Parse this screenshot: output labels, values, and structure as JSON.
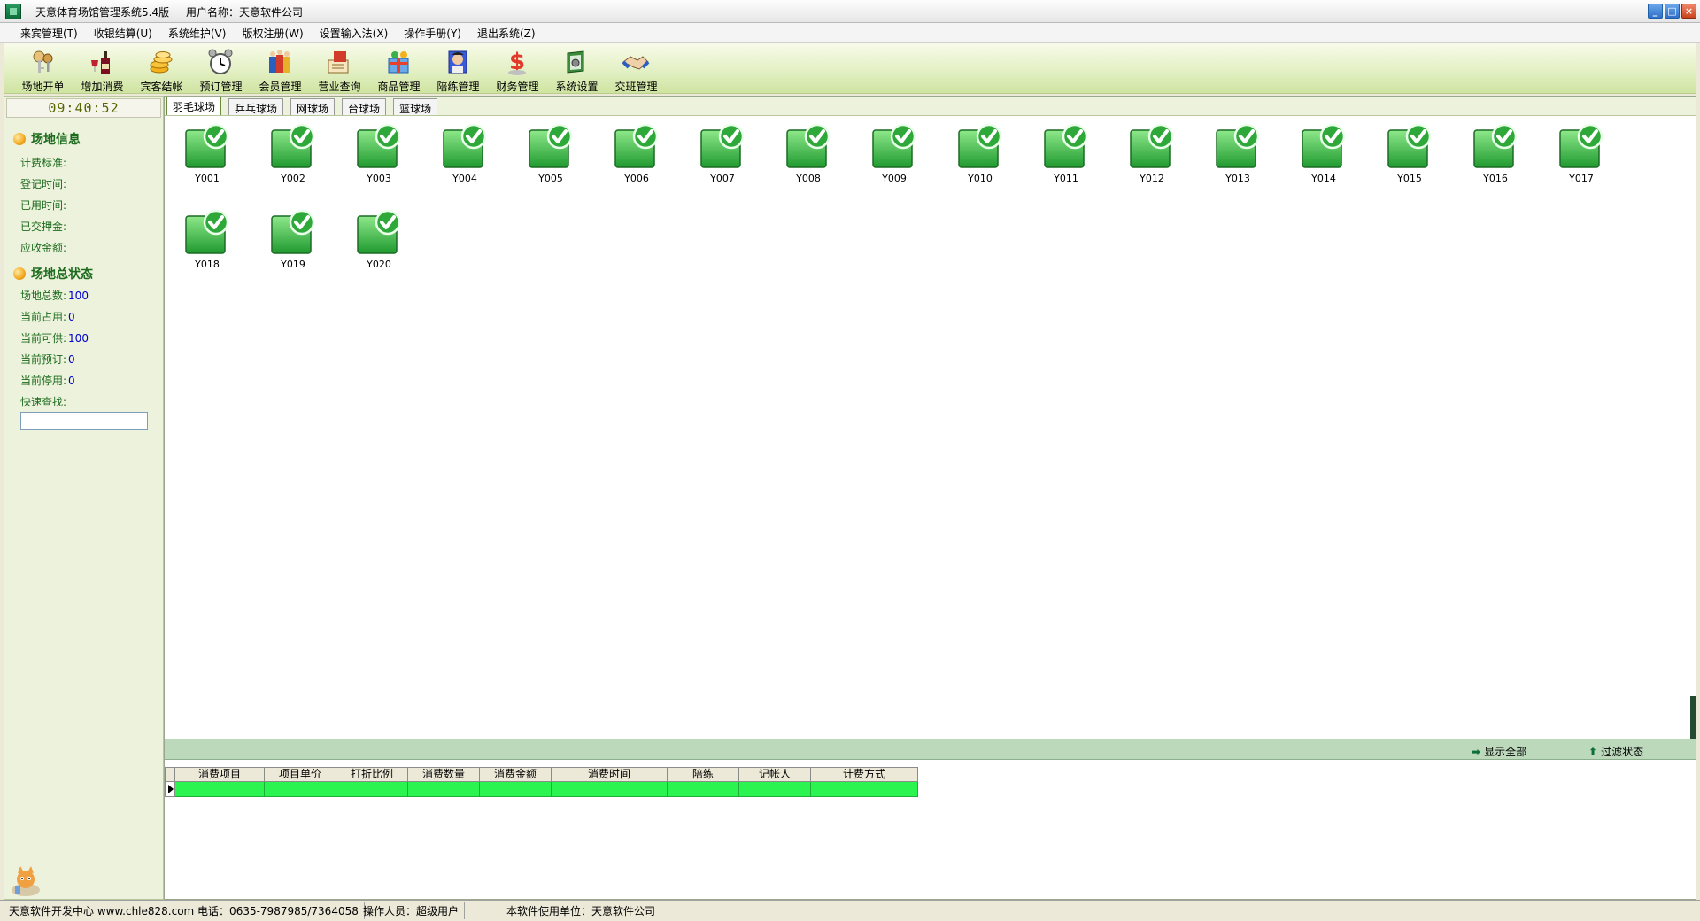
{
  "window": {
    "title": "天意体育场馆管理系统5.4版",
    "user": "用户名称：天意软件公司"
  },
  "menu": [
    "来宾管理(T)",
    "收银结算(U)",
    "系统维护(V)",
    "版权注册(W)",
    "设置输入法(X)",
    "操作手册(Y)",
    "退出系统(Z)"
  ],
  "toolbar": [
    {
      "label": "场地开单",
      "icon": "keys-icon"
    },
    {
      "label": "增加消费",
      "icon": "wine-bottle-icon"
    },
    {
      "label": "宾客结帐",
      "icon": "coins-icon"
    },
    {
      "label": "预订管理",
      "icon": "alarm-clock-icon"
    },
    {
      "label": "会员管理",
      "icon": "members-icon"
    },
    {
      "label": "营业查询",
      "icon": "ledger-icon"
    },
    {
      "label": "商品管理",
      "icon": "gift-box-icon"
    },
    {
      "label": "陪练管理",
      "icon": "trainer-icon"
    },
    {
      "label": "财务管理",
      "icon": "money-icon"
    },
    {
      "label": "系统设置",
      "icon": "settings-book-icon"
    },
    {
      "label": "交班管理",
      "icon": "handshake-icon"
    }
  ],
  "clock": "09:40:52",
  "venue_info": {
    "title": "场地信息",
    "fields": [
      "计费标准:",
      "登记时间:",
      "已用时间:",
      "已交押金:",
      "应收金额:"
    ]
  },
  "venue_status": {
    "title": "场地总状态",
    "fields": [
      {
        "label": "场地总数:",
        "value": "100"
      },
      {
        "label": "当前占用:",
        "value": "0"
      },
      {
        "label": "当前可供:",
        "value": "100"
      },
      {
        "label": "当前预订:",
        "value": "0"
      },
      {
        "label": "当前停用:",
        "value": "0"
      }
    ],
    "quick_search_label": "快速查找:",
    "quick_search_value": ""
  },
  "tabs": [
    {
      "label": "羽毛球场",
      "active": true
    },
    {
      "label": "乒乓球场",
      "active": false
    },
    {
      "label": "网球场",
      "active": false
    },
    {
      "label": "台球场",
      "active": false
    },
    {
      "label": "篮球场",
      "active": false
    }
  ],
  "courts": [
    "Y001",
    "Y002",
    "Y003",
    "Y004",
    "Y005",
    "Y006",
    "Y007",
    "Y008",
    "Y009",
    "Y010",
    "Y011",
    "Y012",
    "Y013",
    "Y014",
    "Y015",
    "Y016",
    "Y017",
    "Y018",
    "Y019",
    "Y020"
  ],
  "bottom_bar": {
    "show_all": "显示全部",
    "filter_status": "过滤状态"
  },
  "table": {
    "columns": [
      "消费项目",
      "项目单价",
      "打折比例",
      "消费数量",
      "消费金额",
      "消费时间",
      "陪练",
      "记帐人",
      "计费方式"
    ],
    "rows": [
      [
        "",
        "",
        "",
        "",
        "",
        "",
        "",
        "",
        ""
      ]
    ]
  },
  "statusbar": {
    "developer": "天意软件开发中心 www.chle828.com 电话：0635-7987985/7364058",
    "operator": "操作人员：超级用户",
    "licensee": "本软件使用单位：天意软件公司"
  },
  "colors": {
    "toolbar_green": "#cfe4a1",
    "court_available": "#2fbf3c",
    "row_highlight": "#2bf34f",
    "panel_text": "#1d6b1d",
    "value_blue": "#0000cc"
  }
}
